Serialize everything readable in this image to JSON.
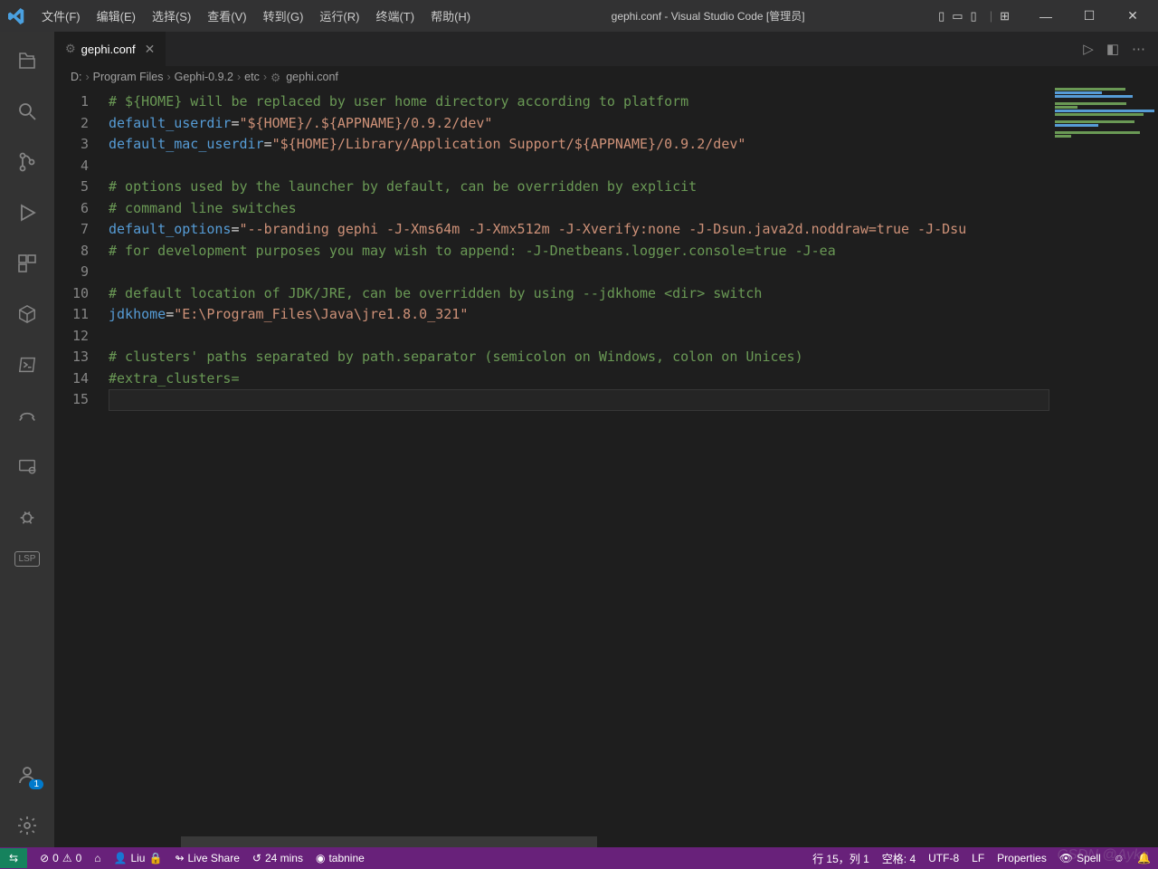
{
  "title": "gephi.conf - Visual Studio Code [管理员]",
  "menu": [
    "文件(F)",
    "编辑(E)",
    "选择(S)",
    "查看(V)",
    "转到(G)",
    "运行(R)",
    "终端(T)",
    "帮助(H)"
  ],
  "tab": {
    "name": "gephi.conf"
  },
  "breadcrumb": [
    "D:",
    "Program Files",
    "Gephi-0.9.2",
    "etc",
    "gephi.conf"
  ],
  "code": {
    "lines": [
      [
        {
          "t": "# ${HOME} will be replaced by user home directory according to platform",
          "c": "c-comment"
        }
      ],
      [
        {
          "t": "default_userdir",
          "c": "c-key"
        },
        {
          "t": "=",
          "c": "c-eq"
        },
        {
          "t": "\"${HOME}/.${APPNAME}/0.9.2/dev\"",
          "c": "c-str"
        }
      ],
      [
        {
          "t": "default_mac_userdir",
          "c": "c-key"
        },
        {
          "t": "=",
          "c": "c-eq"
        },
        {
          "t": "\"${HOME}/Library/Application Support/${APPNAME}/0.9.2/dev\"",
          "c": "c-str"
        }
      ],
      [],
      [
        {
          "t": "# options used by the launcher by default, can be overridden by explicit",
          "c": "c-comment"
        }
      ],
      [
        {
          "t": "# command line switches",
          "c": "c-comment"
        }
      ],
      [
        {
          "t": "default_options",
          "c": "c-key"
        },
        {
          "t": "=",
          "c": "c-eq"
        },
        {
          "t": "\"--branding gephi -J-Xms64m -J-Xmx512m -J-Xverify:none -J-Dsun.java2d.noddraw=true -J-Dsu",
          "c": "c-str"
        }
      ],
      [
        {
          "t": "# for development purposes you may wish to append: -J-Dnetbeans.logger.console=true -J-ea",
          "c": "c-comment"
        }
      ],
      [],
      [
        {
          "t": "# default location of JDK/JRE, can be overridden by using --jdkhome <dir> switch",
          "c": "c-comment"
        }
      ],
      [
        {
          "t": "jdkhome",
          "c": "c-key"
        },
        {
          "t": "=",
          "c": "c-eq"
        },
        {
          "t": "\"E:\\Program_Files\\Java\\jre1.8.0_321\"",
          "c": "c-str"
        }
      ],
      [],
      [
        {
          "t": "# clusters' paths separated by path.separator (semicolon on Windows, colon on Unices)",
          "c": "c-comment"
        }
      ],
      [
        {
          "t": "#extra_clusters=",
          "c": "c-comment"
        }
      ],
      []
    ]
  },
  "status": {
    "errors": "0",
    "warnings": "0",
    "user": "Liu",
    "liveshare": "Live Share",
    "timer": "24 mins",
    "tabnine": "tabnine",
    "pos": "行 15，列 1",
    "indent": "空格: 4",
    "encoding": "UTF-8",
    "eol": "LF",
    "lang": "Properties",
    "spell": "Spell",
    "account_badge": "1"
  },
  "watermark": "CSDN @Ayka"
}
